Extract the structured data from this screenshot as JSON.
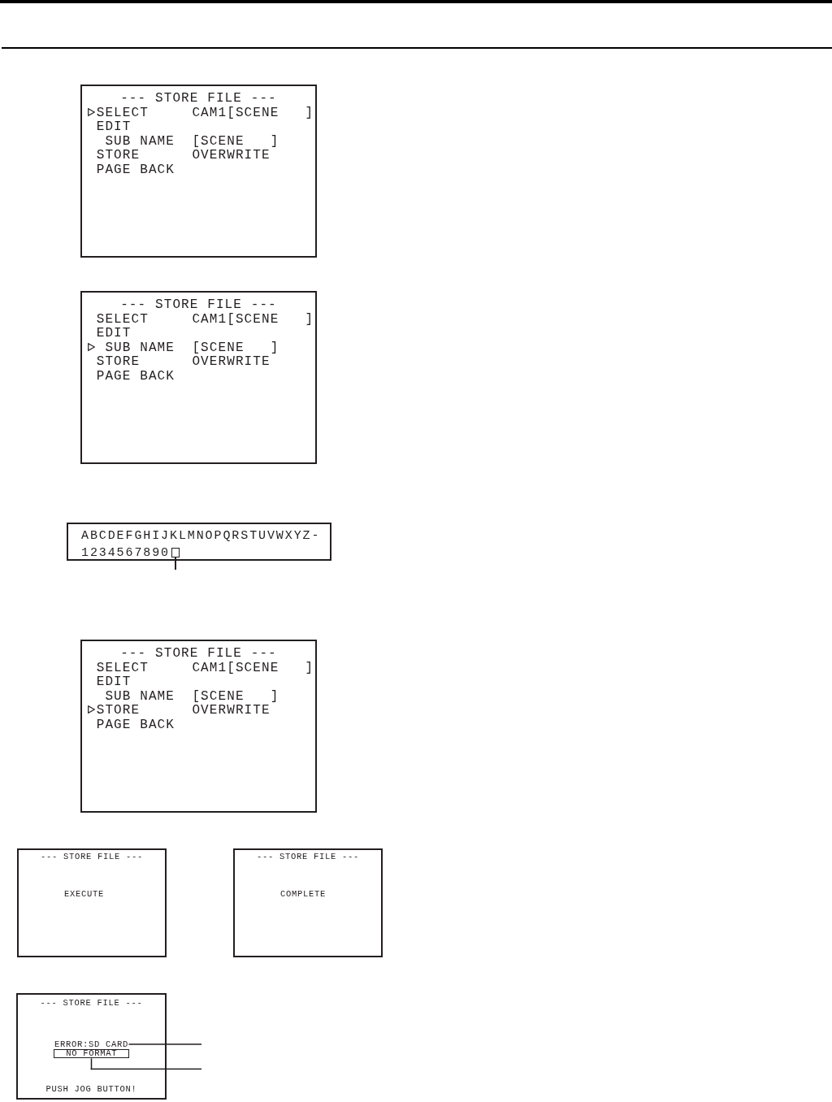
{
  "steps": [
    {
      "screens": [
        {
          "kind": "menu",
          "title": "--- STORE FILE ---",
          "items": [
            {
              "label": "SELECT",
              "value": "CAM1[SCENE   ]",
              "selected": true
            },
            {
              "label": "EDIT",
              "selected": false,
              "children": [
                {
                  "label": "SUB NAME",
                  "value": "[SCENE   ]",
                  "selected": false
                }
              ]
            },
            {
              "label": "STORE",
              "value": "OVERWRITE",
              "selected": false
            },
            {
              "label": "PAGE BACK",
              "selected": false
            }
          ]
        }
      ]
    },
    {
      "screens": [
        {
          "kind": "menu",
          "title": "--- STORE FILE ---",
          "items": [
            {
              "label": "SELECT",
              "value": "CAM1[SCENE   ]",
              "selected": false
            },
            {
              "label": "EDIT",
              "selected": false,
              "children": [
                {
                  "label": "SUB NAME",
                  "value": "[SCENE   ]",
                  "selected": true
                }
              ]
            },
            {
              "label": "STORE",
              "value": "OVERWRITE",
              "selected": false
            },
            {
              "label": "PAGE BACK",
              "selected": false
            }
          ]
        }
      ]
    },
    {
      "screens": [
        {
          "kind": "palette",
          "lines": [
            {
              "characters": "ABCDEFGHIJKLMNOPQRSTUVWXYZ-"
            },
            {
              "characters": "1234567890",
              "space_cell": {
                "selected": true
              }
            }
          ]
        }
      ]
    },
    {
      "screens": [
        {
          "kind": "menu",
          "title": "--- STORE FILE ---",
          "items": [
            {
              "label": "SELECT",
              "value": "CAM1[SCENE   ]",
              "selected": false
            },
            {
              "label": "EDIT",
              "selected": false,
              "children": [
                {
                  "label": "SUB NAME",
                  "value": "[SCENE   ]",
                  "selected": false
                }
              ]
            },
            {
              "label": "STORE",
              "value": "OVERWRITE",
              "selected": true
            },
            {
              "label": "PAGE BACK",
              "selected": false
            }
          ]
        }
      ]
    },
    {
      "screens": [
        {
          "kind": "message",
          "title": "--- STORE FILE ---",
          "message": "EXECUTE"
        },
        {
          "kind": "message",
          "title": "--- STORE FILE ---",
          "message": "COMPLETE"
        }
      ]
    },
    {
      "screens": [
        {
          "kind": "error",
          "title": "--- STORE FILE ---",
          "lines": [
            {
              "text": "ERROR:SD CARD",
              "framed": false
            },
            {
              "text": "NO FORMAT",
              "framed": true
            }
          ],
          "footer": "PUSH JOG BUTTON!"
        }
      ]
    }
  ]
}
